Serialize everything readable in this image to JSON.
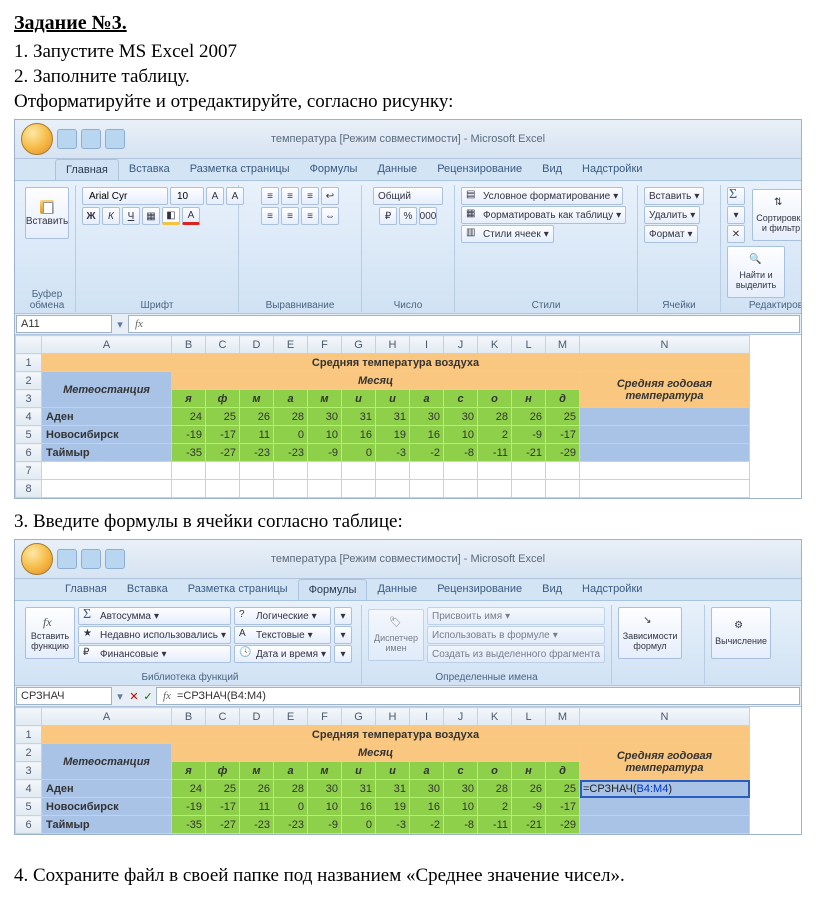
{
  "task": {
    "title": "Задание №3.",
    "step1": "1. Запустите MS Excel 2007",
    "step2": "2. Заполните таблицу.",
    "step2b": "Отформатируйте и отредактируйте, согласно рисунку:",
    "step3": "3. Введите формулы в ячейки согласно таблице:",
    "step4": "4. Сохраните файл в своей папке под названием «Среднее значение чисел»."
  },
  "excel_common": {
    "win_title": "температура  [Режим совместимости] - Microsoft Excel",
    "tabs": [
      "Главная",
      "Вставка",
      "Разметка страницы",
      "Формулы",
      "Данные",
      "Рецензирование",
      "Вид",
      "Надстройки"
    ],
    "paste_label": "Вставить",
    "clipboard_label": "Буфер обмена",
    "font_name": "Arial Cyr",
    "font_size": "10",
    "font_label": "Шрифт",
    "align_label": "Выравнивание",
    "number_combo": "Общий",
    "number_label": "Число",
    "cond_fmt": "Условное форматирование",
    "as_table": "Форматировать как таблицу",
    "cell_styles": "Стили ячеек",
    "styles_label": "Стили",
    "ins": "Вставить",
    "del": "Удалить",
    "fmt": "Формат",
    "cells_label": "Ячейки",
    "sort": "Сортировка и фильтр",
    "find": "Найти и выделить",
    "edit_label": "Редактирование",
    "namebox1": "A11",
    "insert_func_label": "Вставить функцию",
    "autosum": "Автосумма",
    "recent": "Недавно использовались",
    "financial": "Финансовые",
    "lib_label": "Библиотека функций",
    "logical": "Логические",
    "text_f": "Текстовые",
    "datetime": "Дата и время",
    "name_mgr": "Диспетчер имен",
    "assign": "Присвоить имя",
    "use_in": "Использовать в формуле",
    "create_sel": "Создать из выделенного фрагмента",
    "defnames_label": "Определенные имена",
    "deps": "Зависимости формул",
    "calc": "Вычисление",
    "namebox2": "СРЗНАЧ",
    "formula_bar": "=СРЗНАЧ(B4:M4)",
    "formula_cell_prefix": "=СРЗНАЧ(",
    "formula_cell_ref": "B4:M4",
    "formula_cell_suffix": ")"
  },
  "table": {
    "cols": [
      "A",
      "B",
      "C",
      "D",
      "E",
      "F",
      "G",
      "H",
      "I",
      "J",
      "K",
      "L",
      "M",
      "N"
    ],
    "widths": [
      130,
      34,
      34,
      34,
      34,
      34,
      34,
      34,
      34,
      34,
      34,
      34,
      34,
      170
    ],
    "title": "Средняя температура воздуха",
    "month_header": "Месяц",
    "avg_header": "Средняя годовая температура",
    "station_header": "Метеостанция",
    "months": [
      "я",
      "ф",
      "м",
      "а",
      "м",
      "и",
      "и",
      "а",
      "с",
      "о",
      "н",
      "д"
    ],
    "rows": [
      {
        "name": "Аден",
        "vals": [
          24,
          25,
          26,
          28,
          30,
          31,
          31,
          30,
          30,
          28,
          26,
          25
        ]
      },
      {
        "name": "Новосибирск",
        "vals": [
          -19,
          -17,
          11,
          0,
          10,
          16,
          19,
          16,
          10,
          2,
          -9,
          -17
        ]
      },
      {
        "name": "Таймыр",
        "vals": [
          -35,
          -27,
          -23,
          -23,
          -9,
          0,
          -3,
          -2,
          -8,
          -11,
          -21,
          -29
        ]
      }
    ]
  },
  "chart_data": {
    "type": "table",
    "title": "Средняя температура воздуха",
    "categories": [
      "я",
      "ф",
      "м",
      "а",
      "м",
      "и",
      "и",
      "а",
      "с",
      "о",
      "н",
      "д"
    ],
    "series": [
      {
        "name": "Аден",
        "values": [
          24,
          25,
          26,
          28,
          30,
          31,
          31,
          30,
          30,
          28,
          26,
          25
        ]
      },
      {
        "name": "Новосибирск",
        "values": [
          -19,
          -17,
          11,
          0,
          10,
          16,
          19,
          16,
          10,
          2,
          -9,
          -17
        ]
      },
      {
        "name": "Таймыр",
        "values": [
          -35,
          -27,
          -23,
          -23,
          -9,
          0,
          -3,
          -2,
          -8,
          -11,
          -21,
          -29
        ]
      }
    ],
    "xlabel": "Месяц",
    "ylabel": "Средняя годовая температура"
  }
}
